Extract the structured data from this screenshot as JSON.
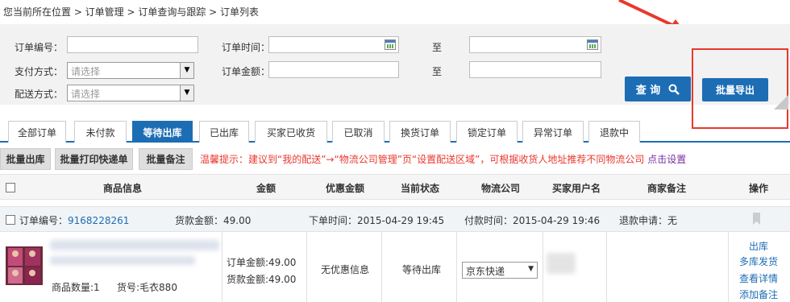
{
  "breadcrumb": "您当前所在位置 > 订单管理 > 订单查询与跟踪 > 订单列表",
  "filters": {
    "order_no_label": "订单编号：",
    "order_time_label": "订单时间：",
    "to_label_1": "至",
    "pay_method_label": "支付方式：",
    "pay_method_value": "请选择",
    "order_amount_label": "订单金额：",
    "to_label_2": "至",
    "delivery_label": "配送方式：",
    "delivery_value": "请选择"
  },
  "buttons": {
    "query": "查 询",
    "export": "批量导出"
  },
  "tabs": [
    {
      "label": "全部订单"
    },
    {
      "label": "未付款"
    },
    {
      "label": "等待出库"
    },
    {
      "label": "已出库"
    },
    {
      "label": "买家已收货"
    },
    {
      "label": "已取消"
    },
    {
      "label": "换货订单"
    },
    {
      "label": "锁定订单"
    },
    {
      "label": "异常订单"
    },
    {
      "label": "退款中"
    }
  ],
  "active_tab": "等待出库",
  "actions": {
    "batch_ship": "批量出库",
    "batch_print": "批量打印快递单",
    "batch_note": "批量备注"
  },
  "tip": {
    "text": "温馨提示：建议到“我的配送”→“物流公司管理”页“设置配送区域”，可根据收货人地址推荐不同物流公司",
    "link": "点击设置"
  },
  "table_headers": {
    "product": "商品信息",
    "amount": "金额",
    "discount": "优惠金额",
    "status": "当前状态",
    "logistics": "物流公司",
    "buyer": "买家用户名",
    "merchant_note": "商家备注",
    "ops": "操作"
  },
  "order": {
    "order_no_label": "订单编号：",
    "order_no": "9168228261",
    "goods_amount": "货款金额：49.00",
    "order_time": "下单时间：2015-04-29 19:45",
    "pay_time": "付款时间：2015-04-29 19:46",
    "refund": "退款申请：无",
    "qty": "商品数量:1",
    "sku": "货号:毛衣880",
    "order_amount": "订单金额:49.00",
    "goods_amount_2": "货款金额:49.00",
    "discount": "无优惠信息",
    "status": "等待出库",
    "logistics": "京东快递",
    "ops": [
      "出库",
      "多库发货",
      "查看详情",
      "添加备注"
    ]
  },
  "colors": {
    "accent": "#1d6db5",
    "highlight_box": "#e8382d",
    "tip_text": "#e8382d"
  }
}
